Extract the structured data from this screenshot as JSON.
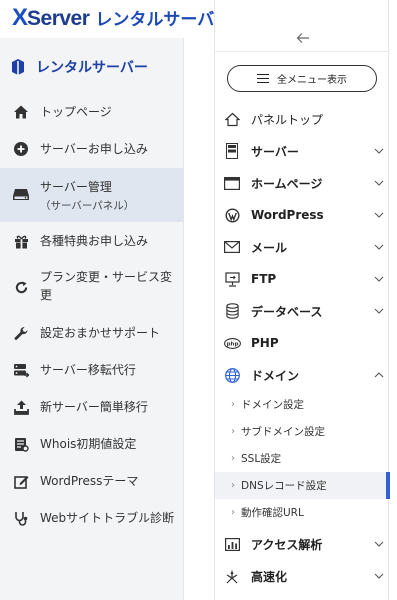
{
  "logo": {
    "x": "X",
    "brand": "Server",
    "sub": "レンタルサーバー"
  },
  "sidebar": {
    "title": "レンタルサーバー",
    "items": [
      {
        "label": "トップページ",
        "icon": "home-icon"
      },
      {
        "label": "サーバーお申し込み",
        "icon": "plus-circle-icon"
      },
      {
        "label": "サーバー管理",
        "sub": "（サーバーパネル）",
        "icon": "server-drive-icon"
      },
      {
        "label": "各種特典お申し込み",
        "icon": "gift-icon"
      },
      {
        "label": "プラン変更・サービス変",
        "label2": "更",
        "icon": "refresh-icon"
      },
      {
        "label": "設定おまかせサポート",
        "icon": "wrench-icon"
      },
      {
        "label": "サーバー移転代行",
        "icon": "server-transfer-icon"
      },
      {
        "label": "新サーバー簡単移行",
        "icon": "upload-icon"
      },
      {
        "label": "Whois初期値設定",
        "icon": "whois-icon"
      },
      {
        "label": "WordPressテーマ",
        "icon": "edit-icon"
      },
      {
        "label": "Webサイトトラブル診断",
        "icon": "stethoscope-icon"
      }
    ]
  },
  "panel": {
    "menu_button": "全メニュー表示",
    "items": [
      {
        "label": "パネルトップ",
        "icon": "home-outline-icon"
      },
      {
        "label": "サーバー",
        "icon": "server-icon"
      },
      {
        "label": "ホームページ",
        "icon": "browser-icon"
      },
      {
        "label": "WordPress",
        "icon": "wordpress-icon"
      },
      {
        "label": "メール",
        "icon": "mail-icon"
      },
      {
        "label": "FTP",
        "icon": "ftp-monitor-icon"
      },
      {
        "label": "データベース",
        "icon": "database-icon"
      },
      {
        "label": "PHP",
        "icon": "php-icon"
      },
      {
        "label": "ドメイン",
        "icon": "globe-icon"
      }
    ],
    "domain_sub": [
      {
        "label": "ドメイン設定"
      },
      {
        "label": "サブドメイン設定"
      },
      {
        "label": "SSL設定"
      },
      {
        "label": "DNSレコード設定"
      },
      {
        "label": "動作確認URL"
      }
    ],
    "bottom_items": [
      {
        "label": "アクセス解析",
        "icon": "analytics-icon"
      },
      {
        "label": "高速化",
        "icon": "speed-icon"
      }
    ]
  },
  "colors": {
    "brand": "#1d3b8f",
    "accent": "#2e63d6",
    "sidebar_bg": "#f2f4f6",
    "active_bg": "#dfe6ef"
  }
}
